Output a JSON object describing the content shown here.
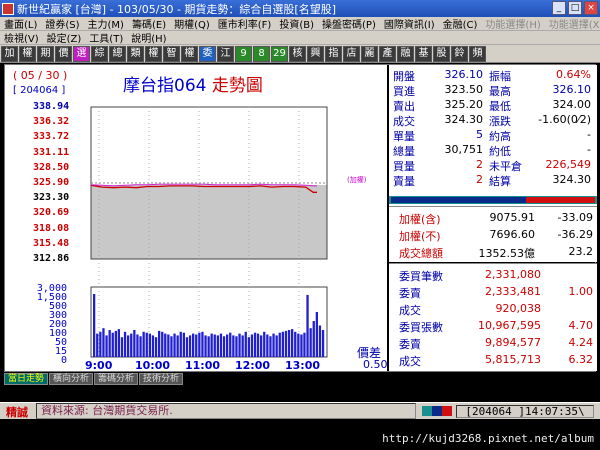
{
  "window": {
    "title": "新世紀贏家 [台灣] - 103/05/30 - 期貨走勢：綜合自選股[名望股]"
  },
  "menu1": [
    "畫面(L)",
    "證券(S)",
    "主力(M)",
    "籌碼(E)",
    "期權(Q)",
    "匯市利率(F)",
    "投資(B)",
    "操盤密碼(P)",
    "國際資訊(I)",
    "金融(C)",
    "功能選擇(H)",
    "功能選擇(X)"
  ],
  "menu2": [
    "檢視(V)",
    "設定(Z)",
    "工具(T)",
    "說明(H)"
  ],
  "toolbar": [
    "加",
    "權",
    "期",
    "價",
    "選",
    "綜",
    "總",
    "類",
    "權",
    "智",
    "權",
    "委",
    "江",
    "9",
    "8",
    "29",
    "核",
    "興",
    "指",
    "店",
    "麗",
    "產",
    "融",
    "基",
    "股",
    "鈴",
    "頻"
  ],
  "chart": {
    "date": "( 05 / 30 )",
    "code": "[ 204064 ]",
    "title_name": "摩台指064",
    "title_suffix": "走勢圖",
    "ref_tag": "(加權)",
    "spread_label": "價差",
    "spread_value": "0.50"
  },
  "chart_data": {
    "type": "line",
    "title": "摩台指064 走勢圖",
    "price_axis_ticks": [
      "338.94",
      "336.32",
      "333.72",
      "331.11",
      "328.50",
      "325.90",
      "323.30",
      "320.69",
      "318.08",
      "315.48",
      "312.86"
    ],
    "price_axis_colors": [
      "#00a",
      "#c00",
      "#c00",
      "#c00",
      "#c00",
      "#c00",
      "#000",
      "#c00",
      "#c00",
      "#c00",
      "#000"
    ],
    "ylim": [
      312.86,
      338.94
    ],
    "reference_price": 325.9,
    "volume_axis_ticks": [
      "3,000",
      "1,500",
      "500",
      "300",
      "200",
      "100",
      "50",
      "15",
      "0"
    ],
    "time_axis_ticks": [
      "9:00",
      "10:00",
      "11:00",
      "12:00",
      "13:00"
    ],
    "series": [
      {
        "name": "摩台指064",
        "color": "#c00",
        "x": [
          "8:45",
          "9:00",
          "9:15",
          "9:30",
          "9:45",
          "10:00",
          "10:15",
          "10:30",
          "10:45",
          "11:00",
          "11:15",
          "11:30",
          "11:45",
          "12:00",
          "12:15",
          "12:30",
          "12:45",
          "13:00",
          "13:15",
          "13:30",
          "13:40",
          "13:45"
        ],
        "values": [
          325.5,
          325.2,
          325.1,
          325.2,
          325.1,
          325.3,
          325.3,
          325.4,
          325.4,
          325.4,
          325.3,
          325.3,
          325.3,
          325.3,
          325.3,
          325.4,
          325.2,
          325.3,
          325.3,
          325.2,
          324.3,
          324.3
        ]
      },
      {
        "name": "加權",
        "color": "#d020d0",
        "x": [
          "8:45",
          "9:00",
          "9:15",
          "9:30",
          "9:45",
          "10:00",
          "10:15",
          "10:30",
          "10:45",
          "11:00",
          "11:15",
          "11:30",
          "11:45",
          "12:00",
          "12:15",
          "12:30",
          "12:45",
          "13:00",
          "13:15",
          "13:30",
          "13:40",
          "13:45"
        ],
        "values": [
          325.6,
          325.5,
          325.4,
          325.5,
          325.6,
          325.6,
          325.7,
          325.7,
          325.7,
          325.7,
          325.7,
          325.6,
          325.6,
          325.6,
          325.6,
          325.7,
          325.6,
          325.6,
          325.6,
          325.5,
          325.4,
          325.4
        ]
      }
    ],
    "volume": [
      1500,
      80,
      90,
      120,
      70,
      100,
      85,
      95,
      110,
      60,
      90,
      70,
      80,
      100,
      75,
      65,
      90,
      85,
      80,
      70,
      60,
      95,
      90,
      80,
      75,
      65,
      80,
      70,
      90,
      85,
      60,
      70,
      80,
      75,
      85,
      90,
      70,
      65,
      80,
      75,
      70,
      80,
      65,
      75,
      85,
      70,
      65,
      80,
      70,
      90,
      60,
      75,
      85,
      80,
      70,
      90,
      75,
      65,
      80,
      70,
      85,
      90,
      95,
      100,
      110,
      90,
      80,
      75,
      85,
      1400,
      120,
      200,
      300,
      150,
      100
    ]
  },
  "quote": [
    {
      "l1": "開盤",
      "v1": "326.10",
      "c1": "blue",
      "l2": "振幅",
      "v2": "0.64%",
      "c2": "red"
    },
    {
      "l1": "買進",
      "v1": "323.50",
      "c1": "blk",
      "l2": "最高",
      "v2": "326.10",
      "c2": "blue"
    },
    {
      "l1": "賣出",
      "v1": "325.20",
      "c1": "blk",
      "l2": "最低",
      "v2": "324.00",
      "c2": "blk"
    },
    {
      "l1": "成交",
      "v1": "324.30",
      "c1": "blk",
      "l2": "漲跌",
      "v2": "-1.60(0⁄2)",
      "c2": "blk"
    },
    {
      "l1": "單量",
      "v1": "5",
      "c1": "blue",
      "l2": "約高",
      "v2": "-",
      "c2": "blk"
    },
    {
      "l1": "總量",
      "v1": "30,751",
      "c1": "blk",
      "l2": "約低",
      "v2": "-",
      "c2": "blk"
    },
    {
      "l1": "買量",
      "v1": "2",
      "c1": "red",
      "l2": "未平倉",
      "v2": "226,549",
      "c2": "red"
    },
    {
      "l1": "賣量",
      "v1": "2",
      "c1": "red",
      "l2": "結算",
      "v2": "324.30",
      "c2": "blk"
    }
  ],
  "index_panel": [
    {
      "label": "加權(含)",
      "value": "9075.91",
      "change": "-33.09"
    },
    {
      "label": "加權(不)",
      "value": "7696.60",
      "change": "-36.29"
    },
    {
      "label": "成交總額",
      "value": "1352.53億",
      "change": "23.2"
    }
  ],
  "order_panel": [
    {
      "label": "委買筆數",
      "value": "2,331,080",
      "change": ""
    },
    {
      "label": "委賣",
      "value": "2,333,481",
      "change": "1.00"
    },
    {
      "label": "成交",
      "value": "920,038",
      "change": ""
    },
    {
      "label": "委買張數",
      "value": "10,967,595",
      "change": "4.70"
    },
    {
      "label": "委賣",
      "value": "9,894,577",
      "change": "4.24"
    },
    {
      "label": "成交",
      "value": "5,815,713",
      "change": "6.32"
    }
  ],
  "tabs": [
    "當日走勢",
    "橫向分析",
    "籌碼分析",
    "技術分析"
  ],
  "status": {
    "mode": "精誠",
    "source": "資料來源: 台灣期貨交易所.",
    "code_time": "[204064 ]14:07:35\\"
  },
  "watermark": "http://kujd3268.pixnet.net/album",
  "colors": {
    "background": "#000000",
    "price_line": "#c00",
    "index_line": "#d020d0",
    "volume": "#2020d0",
    "panel_text_label": "#00a",
    "panel_text_value": "#c00"
  }
}
